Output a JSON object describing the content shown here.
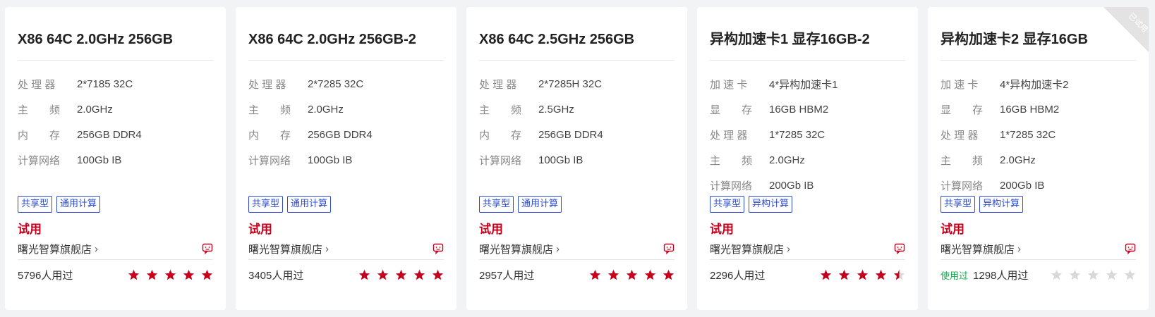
{
  "theme": {
    "accent_red": "#c5001c",
    "tag_blue": "#2b4bd4",
    "used_green": "#17a94f",
    "star_empty": "#d8d8d8"
  },
  "cards": [
    {
      "title": "X86 64C 2.0GHz 256GB",
      "specs": [
        {
          "label": "处 理 器",
          "value": "2*7185 32C"
        },
        {
          "label": "主　　频",
          "value": "2.0GHz"
        },
        {
          "label": "内　　存",
          "value": "256GB DDR4"
        },
        {
          "label": "计算网络",
          "value": "100Gb IB"
        }
      ],
      "tags": [
        "共享型",
        "通用计算"
      ],
      "price": "试用",
      "shop": "曙光智算旗舰店",
      "chevron": "›",
      "usage_badge": "",
      "usage": "5796人用过",
      "rating": 5,
      "ribbon": ""
    },
    {
      "title": "X86 64C 2.0GHz 256GB-2",
      "specs": [
        {
          "label": "处 理 器",
          "value": "2*7285 32C"
        },
        {
          "label": "主　　频",
          "value": "2.0GHz"
        },
        {
          "label": "内　　存",
          "value": "256GB DDR4"
        },
        {
          "label": "计算网络",
          "value": "100Gb IB"
        }
      ],
      "tags": [
        "共享型",
        "通用计算"
      ],
      "price": "试用",
      "shop": "曙光智算旗舰店",
      "chevron": "›",
      "usage_badge": "",
      "usage": "3405人用过",
      "rating": 5,
      "ribbon": ""
    },
    {
      "title": "X86 64C 2.5GHz 256GB",
      "specs": [
        {
          "label": "处 理 器",
          "value": "2*7285H 32C"
        },
        {
          "label": "主　　频",
          "value": "2.5GHz"
        },
        {
          "label": "内　　存",
          "value": "256GB DDR4"
        },
        {
          "label": "计算网络",
          "value": "100Gb IB"
        }
      ],
      "tags": [
        "共享型",
        "通用计算"
      ],
      "price": "试用",
      "shop": "曙光智算旗舰店",
      "chevron": "›",
      "usage_badge": "",
      "usage": "2957人用过",
      "rating": 5,
      "ribbon": ""
    },
    {
      "title": "异构加速卡1 显存16GB-2",
      "specs": [
        {
          "label": "加 速 卡",
          "value": "4*异构加速卡1"
        },
        {
          "label": "显　　存",
          "value": "16GB HBM2"
        },
        {
          "label": "处 理 器",
          "value": "1*7285 32C"
        },
        {
          "label": "主　　频",
          "value": "2.0GHz"
        },
        {
          "label": "计算网络",
          "value": "200Gb IB"
        }
      ],
      "tags": [
        "共享型",
        "异构计算"
      ],
      "price": "试用",
      "shop": "曙光智算旗舰店",
      "chevron": "›",
      "usage_badge": "",
      "usage": "2296人用过",
      "rating": 4.5,
      "ribbon": ""
    },
    {
      "title": "异构加速卡2 显存16GB",
      "specs": [
        {
          "label": "加 速 卡",
          "value": "4*异构加速卡2"
        },
        {
          "label": "显　　存",
          "value": "16GB HBM2"
        },
        {
          "label": "处 理 器",
          "value": "1*7285 32C"
        },
        {
          "label": "主　　频",
          "value": "2.0GHz"
        },
        {
          "label": "计算网络",
          "value": "200Gb IB"
        }
      ],
      "tags": [
        "共享型",
        "异构计算"
      ],
      "price": "试用",
      "shop": "曙光智算旗舰店",
      "chevron": "›",
      "usage_badge": "使用过",
      "usage": "1298人用过",
      "rating": 0,
      "ribbon": "已试用"
    }
  ],
  "icons": {
    "chat": "chat-bubble-icon",
    "star": "star-icon",
    "chevron": "chevron-right-icon"
  }
}
